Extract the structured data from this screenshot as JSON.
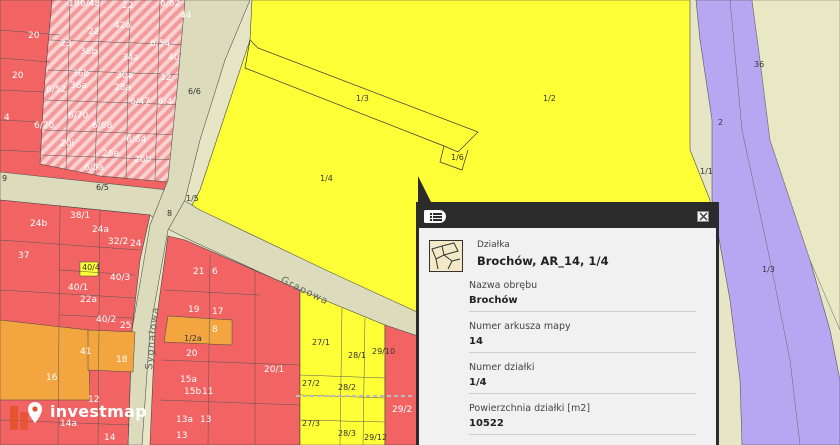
{
  "map": {
    "streets": [
      "Grapowa",
      "Sygnałowa"
    ],
    "plot_numbers": [
      "1/3",
      "1/2",
      "1/4",
      "1/6",
      "1/7",
      "1/1",
      "2",
      "1/3",
      "36",
      "1/5",
      "6/5",
      "6/6",
      "8",
      "18",
      "20",
      "20",
      "21",
      "22",
      "23",
      "24",
      "24a",
      "24b",
      "32/2",
      "38/1",
      "37",
      "40/3",
      "40/1",
      "22a",
      "40/2",
      "25",
      "41",
      "18",
      "16",
      "15a",
      "15b",
      "13a",
      "14",
      "14a",
      "19",
      "17",
      "20/1",
      "21",
      "27/1",
      "28/1",
      "29/10",
      "27/2",
      "28/2",
      "27/3",
      "28/3",
      "29/12",
      "29/2",
      "44",
      "42a",
      "38b",
      "36b",
      "30a",
      "28a",
      "26b",
      "26e",
      "6/52",
      "6/70",
      "6/71",
      "6/64",
      "6/62",
      "34a",
      "32",
      "40",
      "20i",
      "1/2a",
      "8",
      "6/4",
      "6/5a"
    ],
    "colors": {
      "agricultural": "#ffff33",
      "built": "#f26464",
      "road": "#dcdcbc",
      "water": "#b7a6f2",
      "orange": "#f3a640",
      "hatched": "#f5a3a3"
    }
  },
  "popup": {
    "type": "Działka",
    "title": "Brochów, AR_14, 1/4",
    "fields": [
      {
        "label": "Nazwa obrębu",
        "value": "Brochów"
      },
      {
        "label": "Numer arkusza mapy",
        "value": "14"
      },
      {
        "label": "Numer działki",
        "value": "1/4"
      },
      {
        "label": "Powierzchnia działki [m2]",
        "value": "10522"
      }
    ],
    "icons": {
      "list": "list-icon",
      "close": "close-icon",
      "parcel": "parcel-map-icon"
    }
  },
  "logo": {
    "text": "investmap"
  }
}
